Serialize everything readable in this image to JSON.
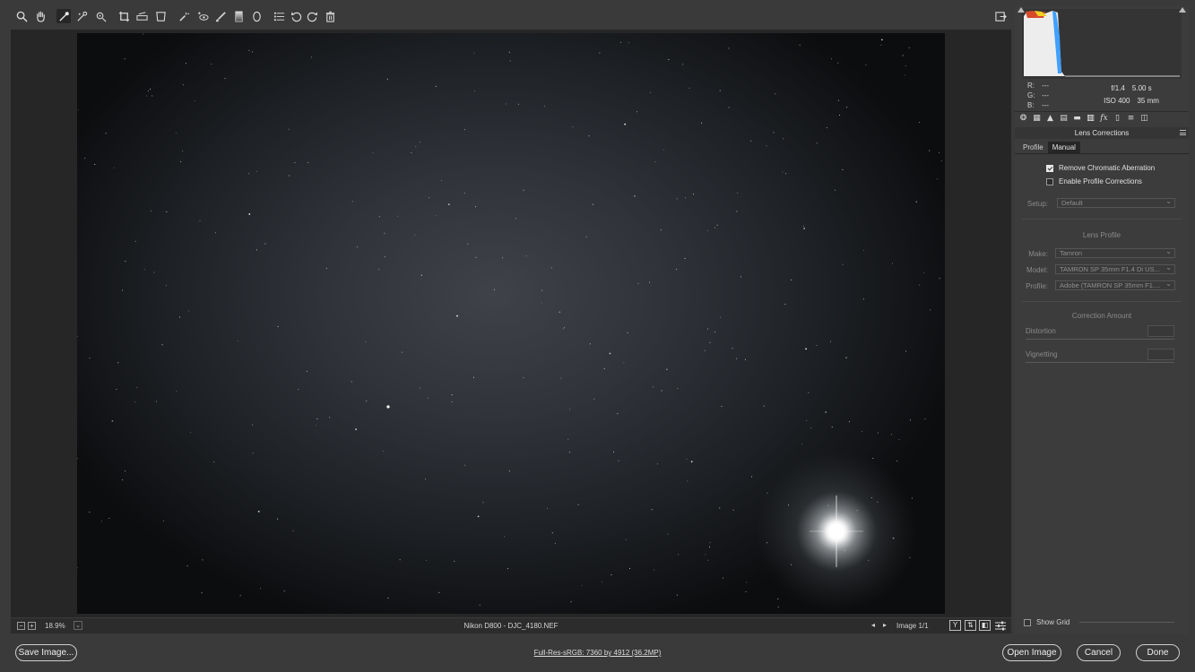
{
  "toolbar": {
    "tools": [
      {
        "name": "zoom-tool",
        "icon": "magnifier-icon"
      },
      {
        "name": "hand-tool",
        "icon": "hand-icon"
      },
      {
        "name": "white-balance-tool",
        "icon": "eyedropper-icon"
      },
      {
        "name": "color-sampler-tool",
        "icon": "color-sampler-icon"
      },
      {
        "name": "targeted-adjustment-tool",
        "icon": "target-adjust-icon"
      },
      {
        "name": "crop-tool",
        "icon": "crop-icon"
      },
      {
        "name": "straighten-tool",
        "icon": "straighten-icon"
      },
      {
        "name": "transform-tool",
        "icon": "transform-icon"
      },
      {
        "name": "spot-removal-tool",
        "icon": "spot-removal-icon"
      },
      {
        "name": "red-eye-tool",
        "icon": "red-eye-icon"
      },
      {
        "name": "adjustment-brush-tool",
        "icon": "brush-icon"
      },
      {
        "name": "graduated-filter-tool",
        "icon": "graduated-filter-icon"
      },
      {
        "name": "radial-filter-tool",
        "icon": "radial-filter-icon"
      },
      {
        "name": "preferences-tool",
        "icon": "list-icon"
      },
      {
        "name": "rotate-left-tool",
        "icon": "rotate-ccw-icon"
      },
      {
        "name": "rotate-right-tool",
        "icon": "rotate-cw-icon"
      },
      {
        "name": "delete-tool",
        "icon": "trash-icon"
      }
    ],
    "fullscreen_icon": "fullscreen-toggle-icon"
  },
  "status": {
    "zoom_minus": "−",
    "zoom_plus": "+",
    "zoom_value": "18.9%",
    "file_info": "Nikon D800  -  DJC_4180.NEF",
    "image_count": "Image 1/1",
    "view_y": "Y",
    "view_before_after": "⇅",
    "view_toggle": "◧",
    "settings_icon": "sliders-icon"
  },
  "panel": {
    "rgb": {
      "r_label": "R:",
      "r_value": "---",
      "g_label": "G:",
      "g_value": "---",
      "b_label": "B:",
      "b_value": "---"
    },
    "exif": {
      "aperture": "f/1.4",
      "shutter": "5.00 s",
      "iso": "ISO 400",
      "focal": "35 mm"
    },
    "section_title": "Lens Corrections",
    "tabs": {
      "profile": "Profile",
      "manual": "Manual"
    },
    "remove_ca_label": "Remove Chromatic Aberration",
    "remove_ca_checked": true,
    "enable_profile_label": "Enable Profile Corrections",
    "enable_profile_checked": false,
    "setup_label": "Setup:",
    "setup_value": "Default",
    "lens_profile_title": "Lens Profile",
    "make_label": "Make:",
    "make_value": "Tamron",
    "model_label": "Model:",
    "model_value": "TAMRON SP 35mm F1.4 Di US...",
    "profile_label": "Profile:",
    "profile_value": "Adobe (TAMRON SP 35mm F1....",
    "correction_amount_title": "Correction Amount",
    "distortion_label": "Distortion",
    "vignetting_label": "Vignetting",
    "show_grid_label": "Show Grid"
  },
  "bottom": {
    "save_label": "Save Image...",
    "workflow_label": "Full-Res-sRGB: 7360 by 4912 (36.2MP)",
    "open_label": "Open Image",
    "cancel_label": "Cancel",
    "done_label": "Done"
  }
}
